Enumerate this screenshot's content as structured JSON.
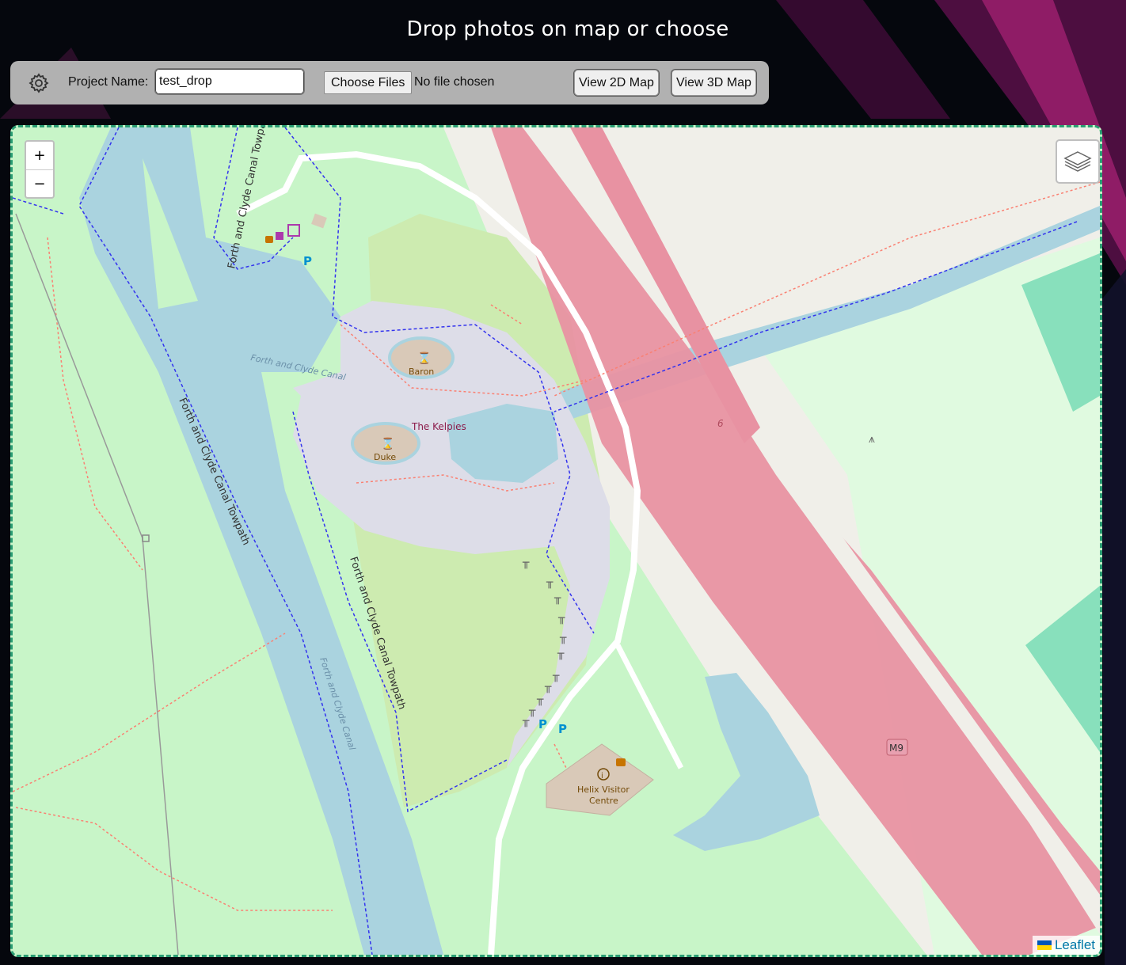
{
  "header": {
    "title": "Drop photos on map or choose"
  },
  "toolbar": {
    "settings_icon": "gear-icon",
    "project_label": "Project Name:",
    "project_value": "test_drop",
    "choose_files_label": "Choose Files",
    "file_status": "No file chosen",
    "view_2d_label": "View 2D Map",
    "view_3d_label": "View 3D Map"
  },
  "map": {
    "zoom_in": "+",
    "zoom_out": "−",
    "layers_icon": "layers-icon",
    "attribution": "Leaflet",
    "labels": {
      "towpath_top": "Forth and Clyde Canal Towpath",
      "towpath_left": "Forth and Clyde Canal Towpath",
      "towpath_center": "Forth and Clyde Canal Towpath",
      "canal_upper": "Forth and Clyde Canal",
      "canal_lower": "Forth and Clyde Canal",
      "baron": "Baron",
      "kelpies": "The Kelpies",
      "duke": "Duke",
      "junction": "6",
      "motorway": "M9",
      "visitor_centre_line1": "Helix Visitor",
      "visitor_centre_line2": "Centre"
    },
    "colors": {
      "park": "#c8f5c8",
      "water": "#aad3df",
      "motorway": "#e892a2",
      "plaza": "#dddde8",
      "land": "#f0efe9",
      "path": "#fa8072",
      "route": "#3333ee"
    }
  }
}
